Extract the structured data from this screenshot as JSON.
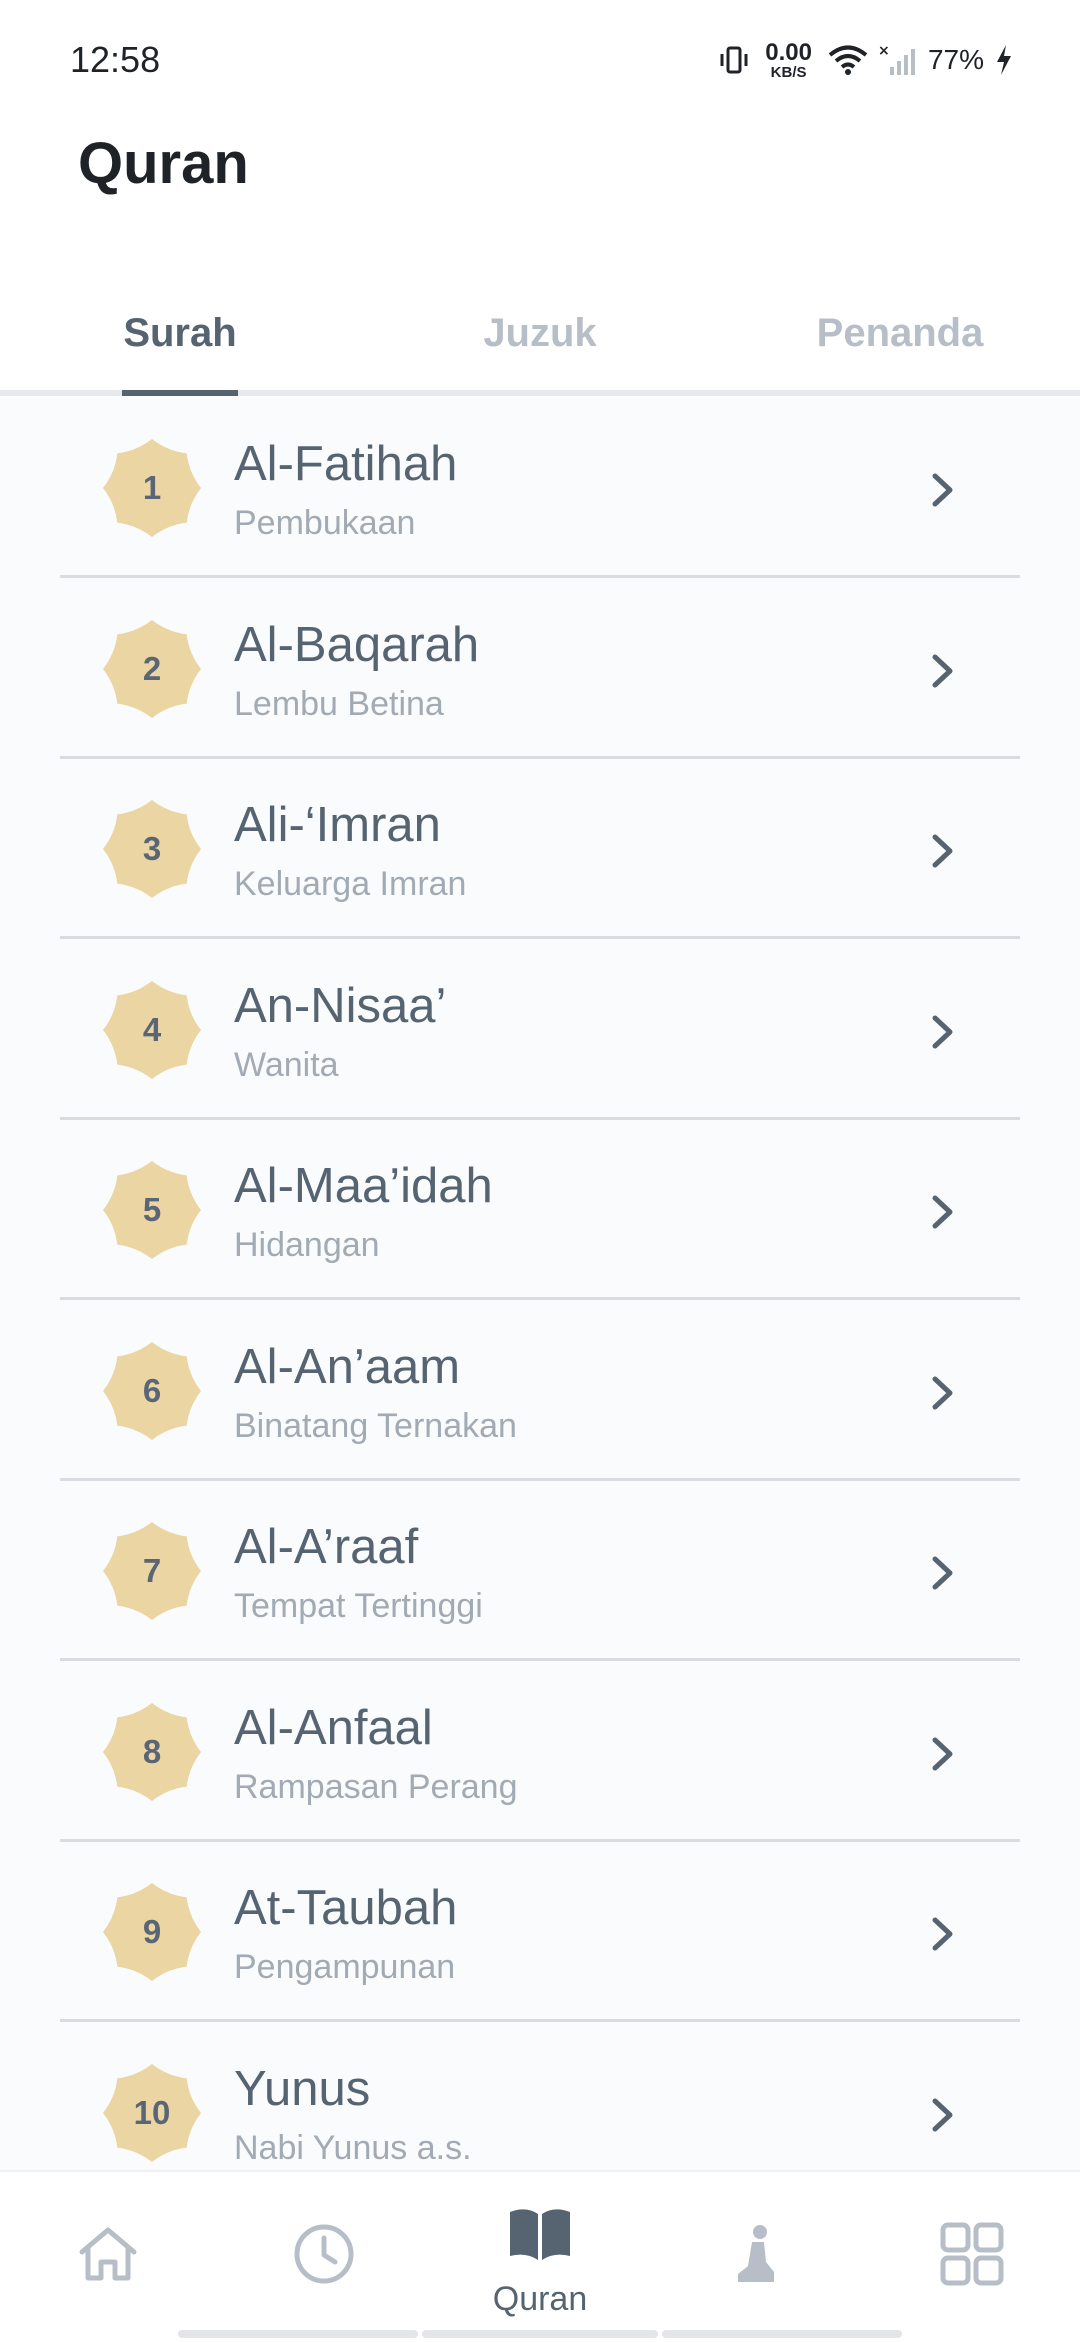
{
  "status_bar": {
    "time": "12:58",
    "speed_value": "0.00",
    "speed_unit": "KB/S",
    "battery": "77%"
  },
  "header": {
    "title": "Quran"
  },
  "tabs": [
    {
      "label": "Surah",
      "active": true
    },
    {
      "label": "Juzuk",
      "active": false
    },
    {
      "label": "Penanda",
      "active": false
    }
  ],
  "surahs": [
    {
      "number": "1",
      "name": "Al-Fatihah",
      "meaning": "Pembukaan"
    },
    {
      "number": "2",
      "name": "Al-Baqarah",
      "meaning": "Lembu Betina"
    },
    {
      "number": "3",
      "name": "Ali-‘Imran",
      "meaning": "Keluarga Imran"
    },
    {
      "number": "4",
      "name": "An-Nisaa’",
      "meaning": "Wanita"
    },
    {
      "number": "5",
      "name": "Al-Maa’idah",
      "meaning": "Hidangan"
    },
    {
      "number": "6",
      "name": "Al-An’aam",
      "meaning": "Binatang Ternakan"
    },
    {
      "number": "7",
      "name": "Al-A’raaf",
      "meaning": "Tempat Tertinggi"
    },
    {
      "number": "8",
      "name": "Al-Anfaal",
      "meaning": "Rampasan Perang"
    },
    {
      "number": "9",
      "name": "At-Taubah",
      "meaning": "Pengampunan"
    },
    {
      "number": "10",
      "name": "Yunus",
      "meaning": "Nabi Yunus a.s."
    }
  ],
  "bottom_nav": {
    "active_label": "Quran",
    "items": [
      "home-icon",
      "clock-icon",
      "quran-book-icon",
      "prayer-icon",
      "grid-icon"
    ]
  },
  "colors": {
    "accent": "#566472",
    "badge": "#ead5a3",
    "muted": "#a2aab3",
    "divider": "#d9dce0"
  }
}
